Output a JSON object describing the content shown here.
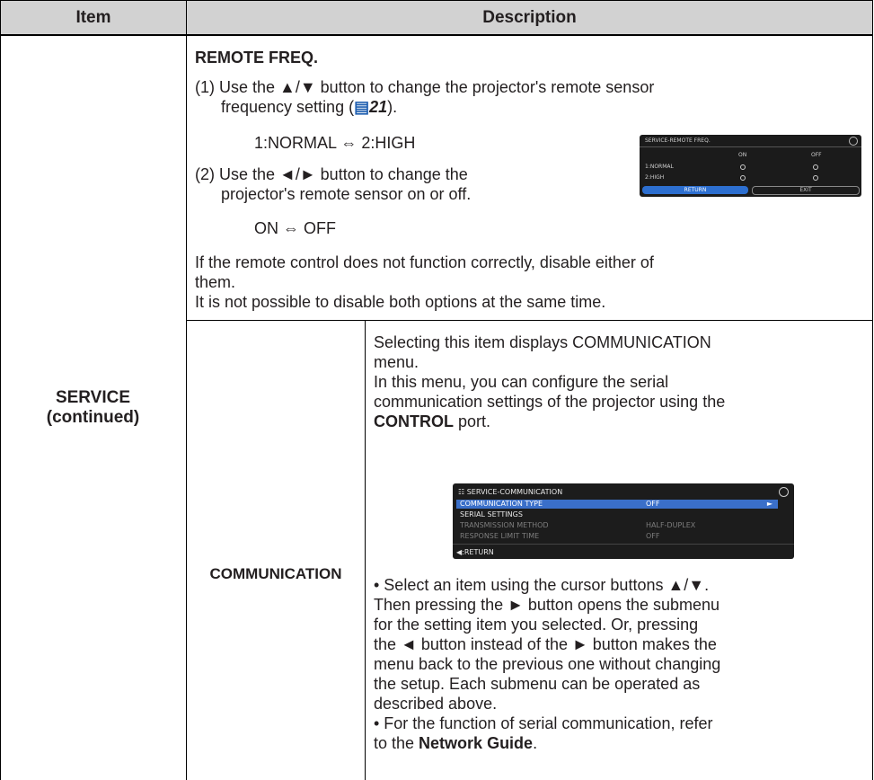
{
  "header": {
    "item": "Item",
    "description": "Description"
  },
  "left_cell": {
    "line1": "SERVICE",
    "line2": "(continued)"
  },
  "remote_freq": {
    "title": "REMOTE FREQ.",
    "step1_a": "(1) Use the ▲/▼ button to change the projector's remote sensor",
    "step1_b_pre": "frequency setting (",
    "step1_b_ref": "21",
    "step1_b_post": ").",
    "options1": "1:NORMAL ⇔ 2:HIGH",
    "step2_a": "(2) Use the ◄/► button to change the",
    "step2_b": "projector's remote sensor on or off.",
    "options2": "ON ⇔ OFF",
    "note1": "If the remote control does not function correctly, disable either of",
    "note2": "them.",
    "note3": "It is not possible to disable both options at the same time.",
    "osd": {
      "title": "SERVICE-REMOTE FREQ.",
      "col_on": "ON",
      "col_off": "OFF",
      "row1": "1:NORMAL",
      "row2": "2:HIGH",
      "return": "RETURN",
      "exit": "EXIT"
    }
  },
  "communication": {
    "label": "COMMUNICATION",
    "p1": "Selecting this item displays COMMUNICATION",
    "p2": "menu.",
    "p3": "In this menu, you can configure the serial",
    "p4": "communication settings of the projector using the",
    "p5_bold": "CONTROL",
    "p5_rest": " port.",
    "b1": "• Select an item using the cursor buttons ▲/▼.",
    "b2": "Then pressing the ► button opens the submenu",
    "b3": "for the setting item you selected. Or, pressing",
    "b4": "the ◄ button instead of the ► button makes the",
    "b5": "menu back to the previous one without changing",
    "b6": "the setup. Each submenu can be operated as",
    "b7": "described above.",
    "b8": "• For the function of serial communication, refer",
    "b9_pre": "to the ",
    "b9_bold": "Network Guide",
    "b9_post": ".",
    "osd": {
      "title": "SERVICE-COMMUNICATION",
      "rows": [
        {
          "label": "COMMUNICATION TYPE",
          "value": "OFF"
        },
        {
          "label": "SERIAL SETTINGS",
          "value": ""
        },
        {
          "label": "TRANSMISSION METHOD",
          "value": "HALF-DUPLEX"
        },
        {
          "label": "RESPONSE LIMIT TIME",
          "value": "OFF"
        }
      ],
      "return": ":RETURN"
    }
  }
}
